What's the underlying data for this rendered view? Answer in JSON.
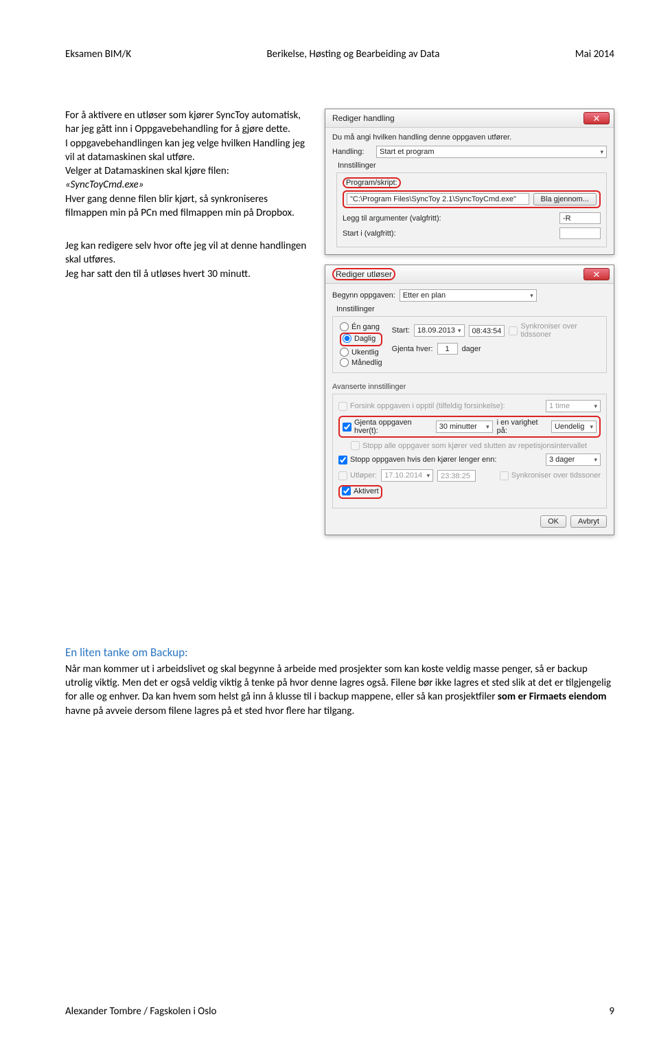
{
  "header": {
    "left": "Eksamen BIM/K",
    "center": "Berikelse, Høsting og Bearbeiding av Data",
    "right": "Mai 2014"
  },
  "leftcol": {
    "p1": "For å aktivere en utløser som kjører SyncToy automatisk, har jeg gått inn i Oppgavebehandling for å gjøre dette.",
    "p2": "I oppgavebehandlingen kan jeg velge hvilken Handling jeg vil at datamaskinen skal utføre.",
    "p3": "Velger at Datamaskinen skal kjøre filen:",
    "p4": "«SyncToyCmd.exe»",
    "p5": "Hver gang denne filen blir kjørt, så synkroniseres filmappen min på PCn med filmappen min på Dropbox.",
    "p6": "Jeg kan redigere selv hvor ofte jeg vil at denne handlingen skal utføres.",
    "p7": "Jeg har satt den til å utløses hvert 30 minutt."
  },
  "dlg1": {
    "title": "Rediger handling",
    "intro": "Du må angi hvilken handling denne oppgaven utfører.",
    "handling_label": "Handling:",
    "handling_value": "Start et program",
    "innst_label": "Innstillinger",
    "prog_label": "Program/skript:",
    "prog_value": "\"C:\\Program Files\\SyncToy 2.1\\SyncToyCmd.exe\"",
    "browse": "Bla gjennom...",
    "args_label": "Legg til argumenter (valgfritt):",
    "args_value": "-R",
    "start_label": "Start i (valgfritt):"
  },
  "dlg2": {
    "title": "Rediger utløser",
    "begynn_label": "Begynn oppgaven:",
    "begynn_value": "Etter en plan",
    "innst_label": "Innstillinger",
    "radio_engang": "Én gang",
    "radio_daglig": "Daglig",
    "radio_ukentlig": "Ukentlig",
    "radio_manedlig": "Månedlig",
    "start_label": "Start:",
    "start_date": "18.09.2013",
    "start_time": "08:43:54",
    "sync_tz": "Synkroniser over tidssoner",
    "gjenta_label": "Gjenta hver:",
    "gjenta_value": "1",
    "gjenta_unit": "dager",
    "adv_title": "Avanserte innstillinger",
    "forsink_label": "Forsink oppgaven i opptil (tilfeldig forsinkelse):",
    "forsink_value": "1 time",
    "gjenta_opp_label": "Gjenta oppgaven hver(t):",
    "gjenta_opp_value": "30 minutter",
    "varighet_label": "i en varighet på:",
    "varighet_value": "Uendelig",
    "stopp_alle": "Stopp alle oppgaver som kjører ved slutten av repetisjonsintervallet",
    "stopp_lenger": "Stopp oppgaven hvis den kjører lenger enn:",
    "stopp_lenger_value": "3 dager",
    "utloper_label": "Utløper:",
    "utloper_date": "17.10.2014",
    "utloper_time": "23:38:25",
    "aktivert": "Aktivert",
    "ok": "OK",
    "avbryt": "Avbryt"
  },
  "backup": {
    "title": "En liten tanke om Backup:",
    "body1": "Når man kommer ut i arbeidslivet og skal begynne å arbeide med prosjekter som kan koste veldig masse penger, så er backup utrolig viktig. Men det er også veldig viktig å tenke på hvor denne lagres også. Filene bør ikke lagres et sted slik at det er tilgjengelig for alle og enhver. Da kan hvem som helst gå inn å klusse til i backup mappene, eller så kan prosjektfiler ",
    "bold": "som er Firmaets eiendom",
    "body2": " havne på avveie dersom filene lagres på et sted hvor flere har tilgang."
  },
  "footer": {
    "author": "Alexander Tombre / Fagskolen i Oslo",
    "pagenum": "9"
  }
}
